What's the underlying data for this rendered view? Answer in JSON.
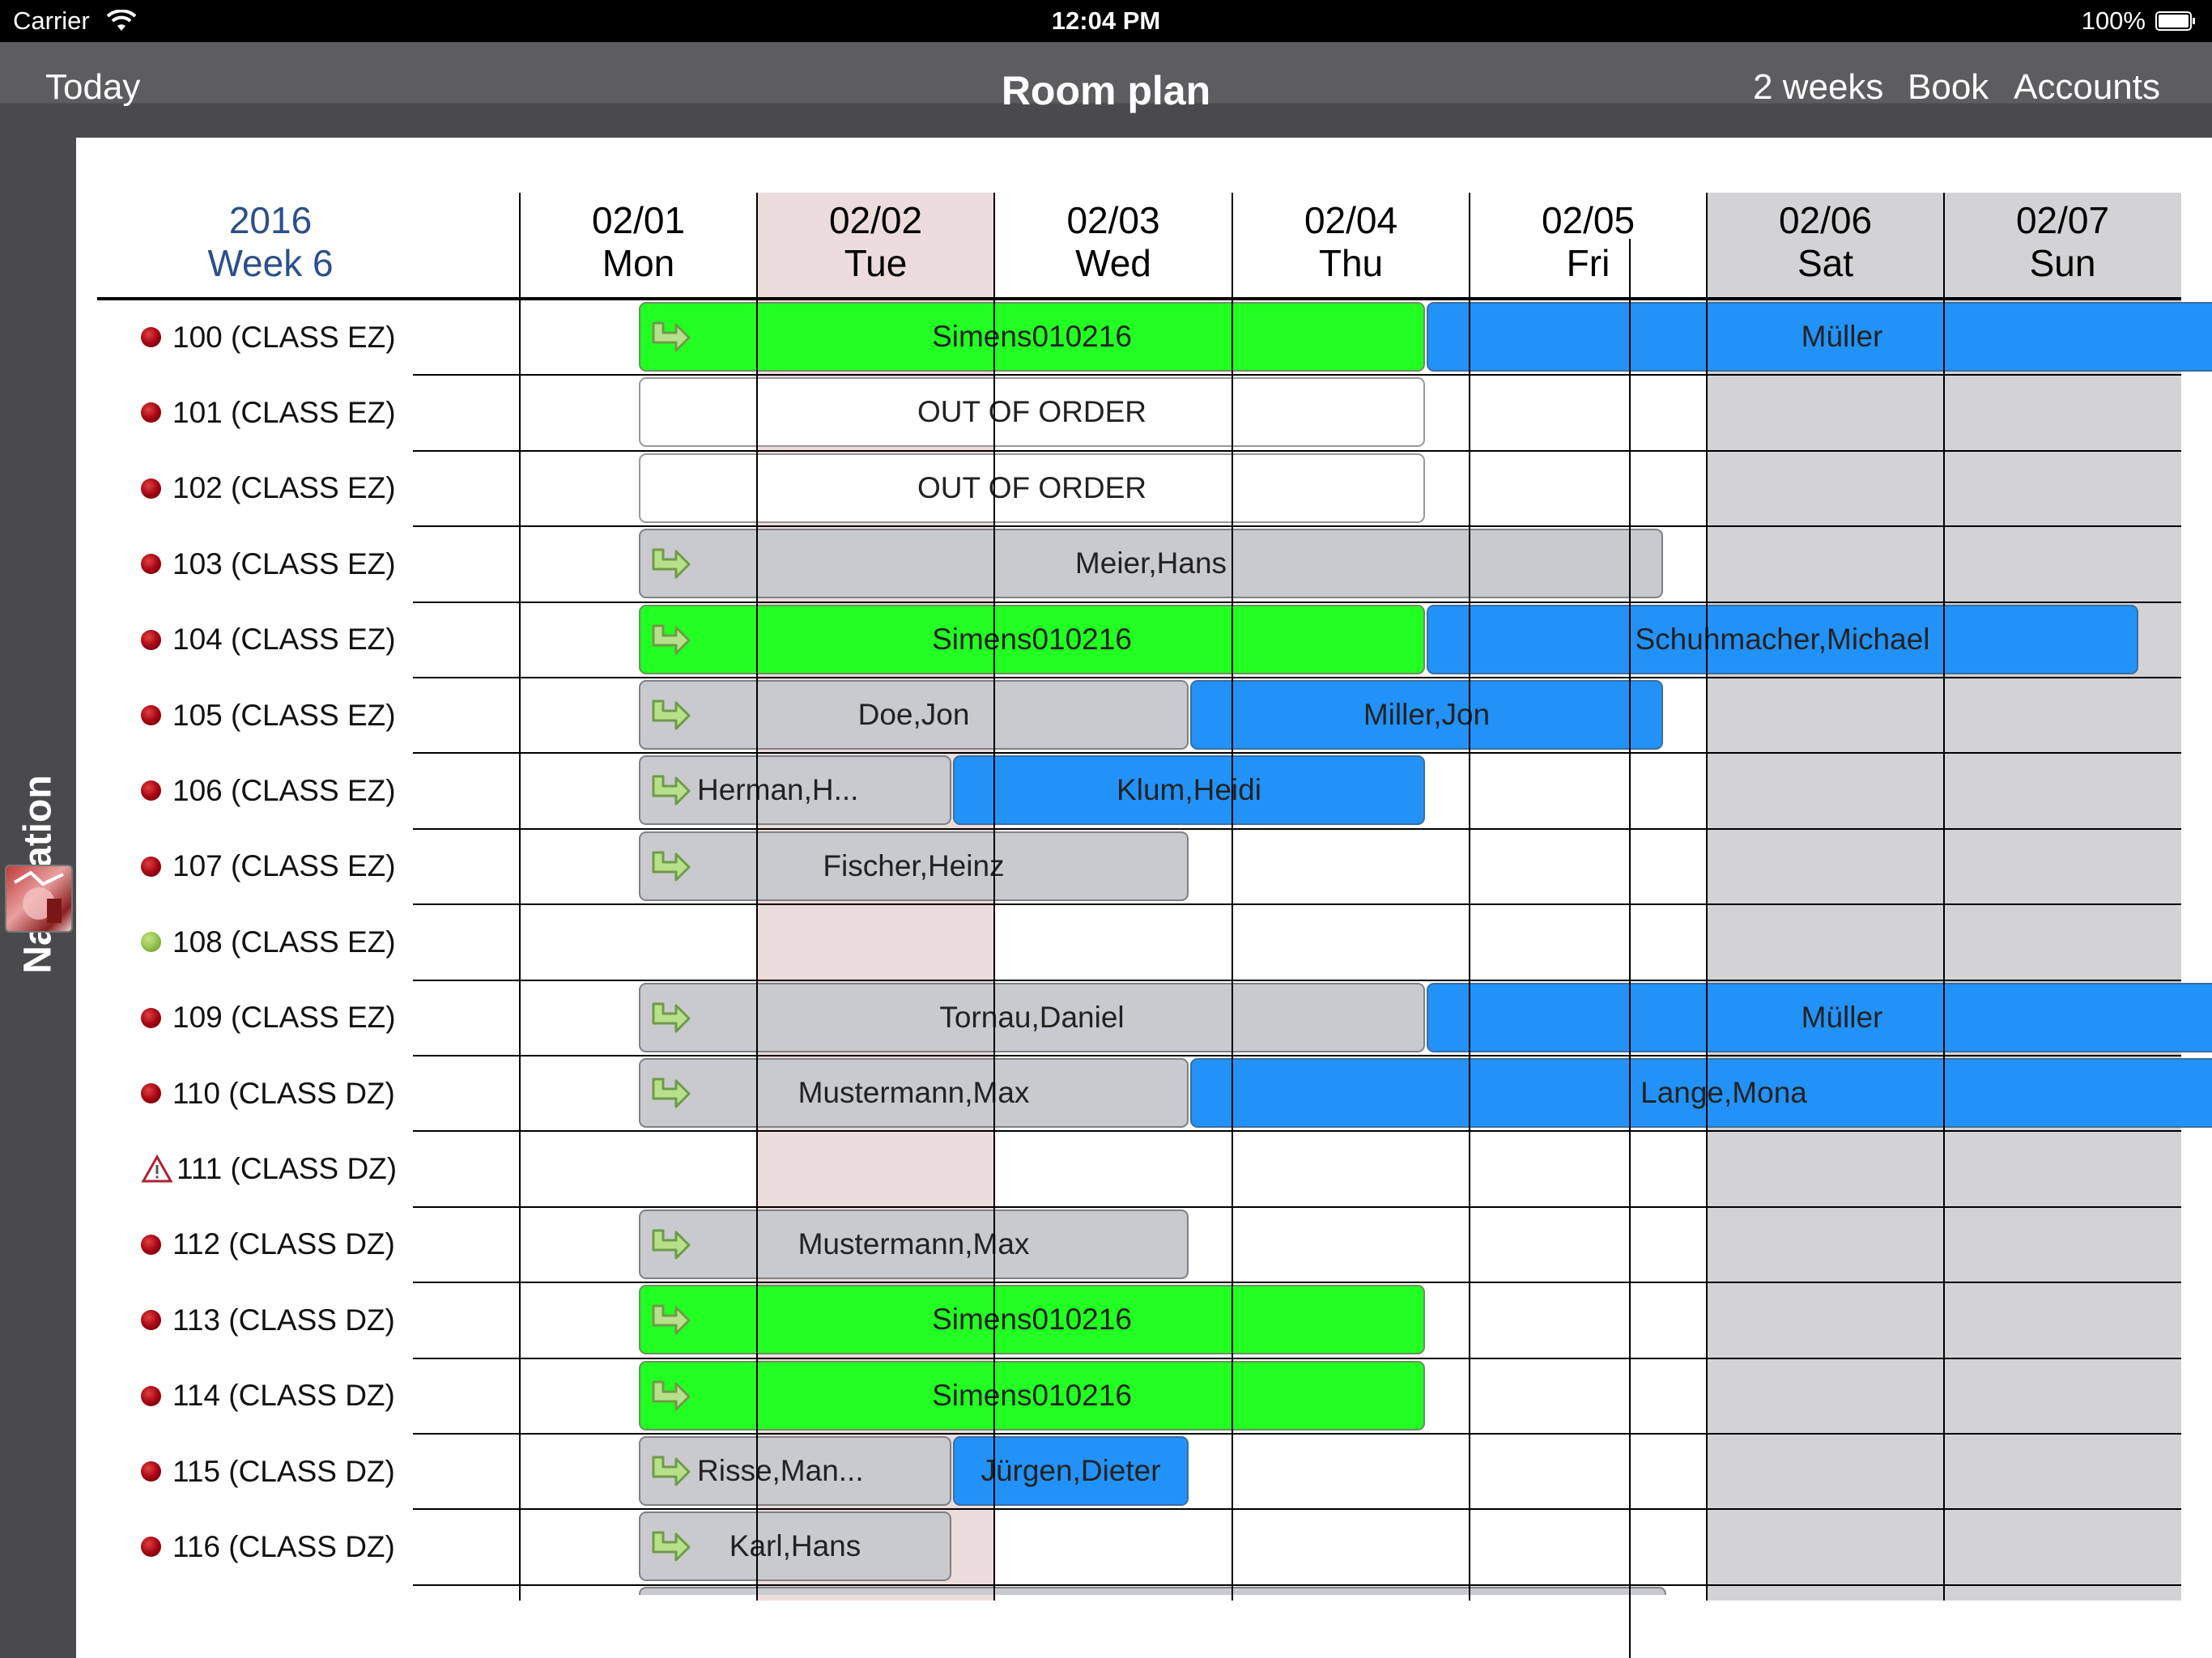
{
  "status_bar": {
    "carrier": "Carrier",
    "time": "12:04 PM",
    "battery": "100%"
  },
  "nav_bar": {
    "today": "Today",
    "title": "Room plan",
    "two_weeks": "2 weeks",
    "book": "Book",
    "accounts": "Accounts"
  },
  "side_nav": {
    "label": "Navigation"
  },
  "calendar": {
    "year": "2016",
    "week": "Week 6",
    "days": [
      {
        "date": "02/01",
        "weekday": "Mon"
      },
      {
        "date": "02/02",
        "weekday": "Tue"
      },
      {
        "date": "02/03",
        "weekday": "Wed"
      },
      {
        "date": "02/04",
        "weekday": "Thu"
      },
      {
        "date": "02/05",
        "weekday": "Fri"
      },
      {
        "date": "02/06",
        "weekday": "Sat"
      },
      {
        "date": "02/07",
        "weekday": "Sun"
      }
    ]
  },
  "rooms": [
    {
      "label": "100 (CLASS EZ)",
      "status": "occupied"
    },
    {
      "label": "101 (CLASS EZ)",
      "status": "occupied"
    },
    {
      "label": "102 (CLASS EZ)",
      "status": "occupied"
    },
    {
      "label": "103 (CLASS EZ)",
      "status": "occupied"
    },
    {
      "label": "104 (CLASS EZ)",
      "status": "occupied"
    },
    {
      "label": "105 (CLASS EZ)",
      "status": "occupied"
    },
    {
      "label": "106 (CLASS EZ)",
      "status": "occupied"
    },
    {
      "label": "107 (CLASS EZ)",
      "status": "occupied"
    },
    {
      "label": "108 (CLASS EZ)",
      "status": "free"
    },
    {
      "label": "109 (CLASS EZ)",
      "status": "occupied"
    },
    {
      "label": "110 (CLASS DZ)",
      "status": "occupied"
    },
    {
      "label": "111 (CLASS DZ)",
      "status": "warning"
    },
    {
      "label": "112 (CLASS DZ)",
      "status": "occupied"
    },
    {
      "label": "113 (CLASS DZ)",
      "status": "occupied"
    },
    {
      "label": "114 (CLASS DZ)",
      "status": "occupied"
    },
    {
      "label": "115 (CLASS DZ)",
      "status": "occupied"
    },
    {
      "label": "116 (CLASS DZ)",
      "status": "occupied"
    }
  ],
  "bookings": [
    {
      "room": 0,
      "name": "Simens010216",
      "color": "green",
      "arrow": true
    },
    {
      "room": 0,
      "name": "Müller",
      "color": "blue",
      "arrow": false
    },
    {
      "room": 1,
      "name": "OUT OF ORDER",
      "color": "white",
      "arrow": false
    },
    {
      "room": 2,
      "name": "OUT OF ORDER",
      "color": "white",
      "arrow": false
    },
    {
      "room": 3,
      "name": "Meier,Hans",
      "color": "grey",
      "arrow": true
    },
    {
      "room": 4,
      "name": "Simens010216",
      "color": "green",
      "arrow": true
    },
    {
      "room": 4,
      "name": "Schuhmacher,Michael",
      "color": "blue",
      "arrow": false
    },
    {
      "room": 5,
      "name": "Doe,Jon",
      "color": "grey",
      "arrow": true
    },
    {
      "room": 5,
      "name": "Miller,Jon",
      "color": "blue",
      "arrow": false
    },
    {
      "room": 6,
      "name": "Herman,H...",
      "color": "grey",
      "arrow": true
    },
    {
      "room": 6,
      "name": "Klum,Heidi",
      "color": "blue",
      "arrow": false
    },
    {
      "room": 7,
      "name": "Fischer,Heinz",
      "color": "grey",
      "arrow": true
    },
    {
      "room": 9,
      "name": "Tornau,Daniel",
      "color": "grey",
      "arrow": true
    },
    {
      "room": 9,
      "name": "Müller",
      "color": "blue",
      "arrow": false
    },
    {
      "room": 10,
      "name": "Mustermann,Max",
      "color": "grey",
      "arrow": true
    },
    {
      "room": 10,
      "name": "Lange,Mona",
      "color": "blue",
      "arrow": false
    },
    {
      "room": 12,
      "name": "Mustermann,Max",
      "color": "grey",
      "arrow": true
    },
    {
      "room": 13,
      "name": "Simens010216",
      "color": "green",
      "arrow": true
    },
    {
      "room": 14,
      "name": "Simens010216",
      "color": "green",
      "arrow": true
    },
    {
      "room": 15,
      "name": "Risse,Man...",
      "color": "grey",
      "arrow": true
    },
    {
      "room": 15,
      "name": "Jürgen,Dieter",
      "color": "blue",
      "arrow": false
    },
    {
      "room": 16,
      "name": "Karl,Hans",
      "color": "grey",
      "arrow": true
    }
  ]
}
